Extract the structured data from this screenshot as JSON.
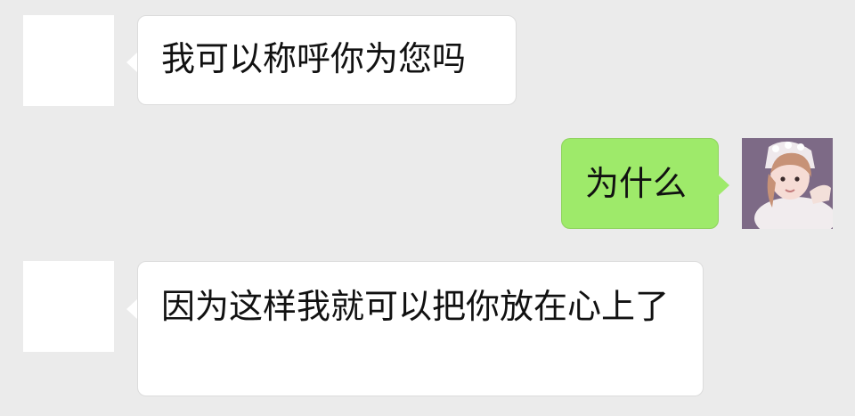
{
  "messages": [
    {
      "side": "left",
      "text": "我可以称呼你为您吗"
    },
    {
      "side": "right",
      "text": "为什么"
    },
    {
      "side": "left",
      "text": "因为这样我就可以把你放在心上了"
    }
  ]
}
